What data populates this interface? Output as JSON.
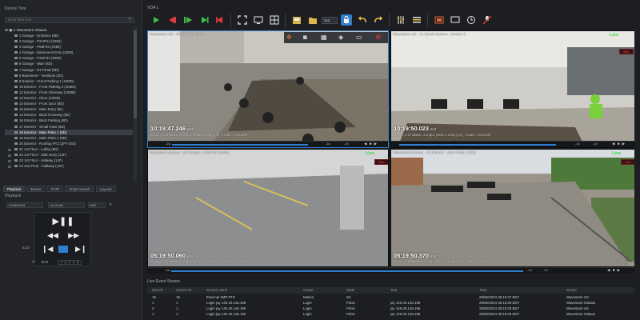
{
  "left_panel": {
    "device_tree_title": "Device Tree",
    "filter_placeholder": "Enter filter text...",
    "root": "1 Wavestore Ottawa",
    "cameras": [
      "1 Garage - Entrance (8B)",
      "2 Garage - P2HFS4 (20MI)",
      "3 Garage - P56FS4 (20MI)",
      "4 Garage - Basement Entry (20MI)",
      "5 Garage - P34FI42 (20MI)",
      "6 Garage - Main (5D)",
      "7 Garage - R1TIF4B (8D)",
      "8 Basement - Vestibule (2D)",
      "9 Exterior - Front Parking 1 (10MD)",
      "10 Exterior - Front Parking 2 (10MD)",
      "12 Exterior - Front Driveway (10MD)",
      "13 Exterior - River (10MD)",
      "14 Exterior - Front Door (8D)",
      "15 Exterior - Main Entry (8L)",
      "14 Exterior - Back Driveway (8D)",
      "16 Exterior - Back Parking (8D)",
      "17 Exterior - Small Patio (8D)",
      "18 Exterior - Main Patio 1 (8D)",
      "19 Exterior - Main Patio 2 (8D)",
      "20 Exterior - Rooftop PTZ (2P7-302)",
      "21 1st Floor - Lobby (8D)",
      "22 1st Floor - Side Entry (12F)",
      "23 1st Floor - Hallway (12F)",
      "24 2nd Floor - Hallway (12F)"
    ],
    "selected_index": 17,
    "tabs": [
      "Playback",
      "Events",
      "PTZF",
      "Smart Search",
      "Layouts"
    ],
    "active_tab": 0,
    "playback": {
      "title": "Playback",
      "date": "27/06/2024",
      "time": "01:20:48",
      "tz": "BST",
      "speed": "x1.0",
      "tech_label": "Tech",
      "speeds": [
        "1",
        "2",
        "3"
      ]
    }
  },
  "vda_title": "VDA 1",
  "toolbar": {
    "layout_value": "2x2"
  },
  "tiles": [
    {
      "name": "Wavestore UK - 03 SNP 6T Dome",
      "timestamp": "10:19:47.246",
      "tz": "BST",
      "info": "25 ips  -  5.18 Mbit/s  -  5.0 Mpx (2592 x 1944) [1:1]  -  H.265  -  YUV420P",
      "live": "",
      "rec": ""
    },
    {
      "name": "Wavestore UK - 11 Quad Camera - Sensor 3",
      "timestamp": "10:19:50.023",
      "tz": "BST",
      "info": "25 ips  -  4.37 Mbit/s  -  5.0 Mpx (2592 x 1944) [1:1]  -  H.265  -  YUV420P",
      "live": "Live",
      "rec": "Rec"
    },
    {
      "name": "Wavestore Ottawa - 03 Garage - P56FS4 (20MI)",
      "timestamp": "05:19:50.060",
      "tz": "EDT",
      "info": "25 ips  -  3.40 Mbit/s  -  3.7 Mpx (2560 x 1440) [1:1]  -  H.265  -  YUV420P",
      "live": "Live",
      "rec": "Rec"
    },
    {
      "name": "Wavestore Ottawa - 18 Exterior - Main Patio 1 (8D)",
      "timestamp": "05:19:50.370",
      "tz": "EDT",
      "info": "25 ips  -  7.65 Mbit/s  -  3.7 Mpx (2560 x 1440) [1:1]  -  H.265  -  YUV420P",
      "live": "Live",
      "rec": "Rec"
    }
  ],
  "timeline_ticks": [
    "-1w",
    "-1d",
    "-1h",
    "-1d",
    "-1h"
  ],
  "events": {
    "title": "Live Event Stream",
    "columns": [
      "Sort ID",
      "Source ID",
      "Source name",
      "Cause",
      "State",
      "Text",
      "Time",
      "Server"
    ],
    "rows": [
      [
        "15",
        "15",
        "External 2MP PTZ",
        "Motion",
        "On",
        "",
        "28/06/2024 05:19:47 BST",
        "Wavestore UK"
      ],
      [
        "1",
        "1",
        "Login jay 145.40.146.196",
        "Login",
        "Pulse",
        "jay 145.40.146.196",
        "28/06/2024 05:19:29 EDT",
        "Wavestore Ottawa"
      ],
      [
        "4",
        "1",
        "Login jay 145.40.146.196",
        "Login",
        "Pulse",
        "jay 145.40.146.196",
        "28/06/2024 05:19:29 BST",
        "Wavestore UK"
      ],
      [
        "1",
        "1",
        "Login jay 145.40.146.196",
        "Login",
        "Pulse",
        "jay 145.40.146.196",
        "28/06/2024 05:19:29 EDT",
        "Wavestore Ottawa"
      ]
    ]
  },
  "colors": {
    "accent": "#2f7fd0",
    "live": "#3fd64a",
    "rec": "#ff4444",
    "background": "#1c1e21"
  },
  "icons": [
    "play-green-icon",
    "stop-red-icon",
    "record-icon",
    "skip-back-icon",
    "skip-forward-icon",
    "fullscreen-icon",
    "monitor-icon",
    "grid-icon",
    "open-folder-icon",
    "lock-icon",
    "undo-icon",
    "redo-icon",
    "sliders-icon",
    "list-icon",
    "window-icon",
    "clock-icon",
    "snapshot-icon",
    "mic-off-icon"
  ]
}
